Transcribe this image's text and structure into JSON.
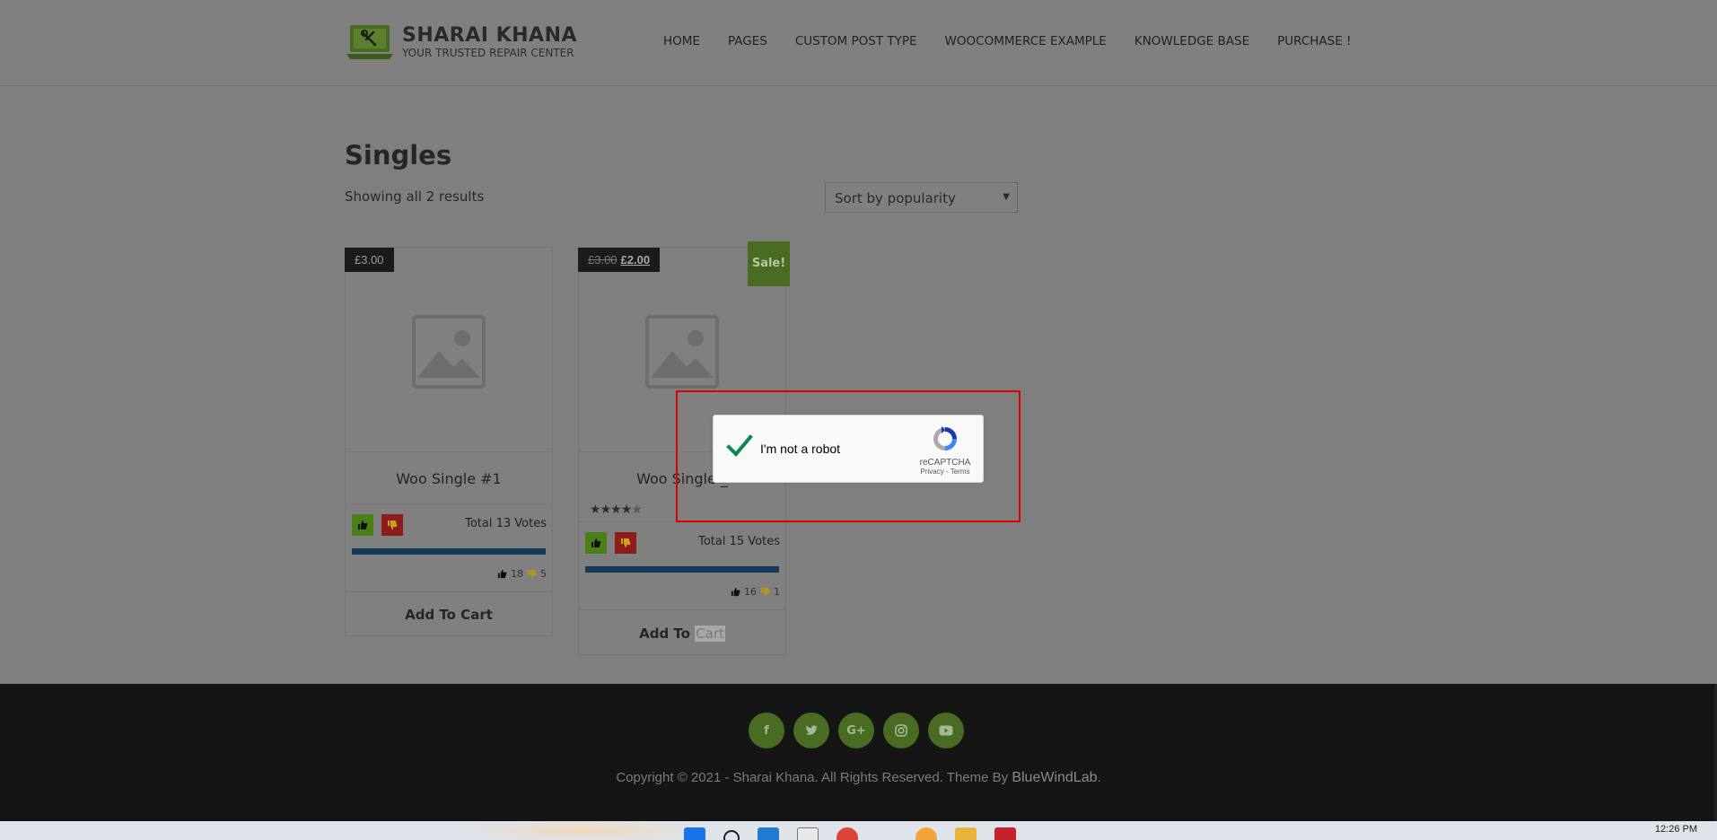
{
  "header": {
    "site_title": "SHARAI KHANA",
    "tagline": "YOUR TRUSTED REPAIR CENTER",
    "nav": [
      "HOME",
      "PAGES",
      "CUSTOM POST TYPE",
      "WOOCOMMERCE EXAMPLE",
      "KNOWLEDGE BASE",
      "PURCHASE !"
    ]
  },
  "main": {
    "title": "Singles",
    "result_count": "Showing all 2 results",
    "sort": {
      "selected": "Sort by popularity"
    }
  },
  "products": [
    {
      "name": "Woo Single #1",
      "price": "£3.00",
      "total_votes": "Total 13 Votes",
      "up": "18",
      "down": "5",
      "add_to_cart_a": "Add To Cart",
      "up_fraction": 1.0
    },
    {
      "name": "Woo Single _",
      "price_old": "£3.00",
      "price_new": "£2.00",
      "sale": "Sale!",
      "rating": 4.5,
      "total_votes": "Total 15 Votes",
      "up": "16",
      "down": "1",
      "add_to_cart_a": "Add To ",
      "add_to_cart_b": "Cart",
      "up_fraction": 1.0
    }
  ],
  "captcha": {
    "label": "I'm not a robot",
    "brand": "reCAPTCHA",
    "links": "Privacy - Terms"
  },
  "footer": {
    "social": [
      "f",
      "t",
      "G+",
      "ig",
      "yt"
    ],
    "copyright": "Copyright © 2021 - Sharai Khana. All Rights Reserved. Theme By ",
    "theme_by": "BlueWindLab",
    "period": "."
  },
  "taskbar": {
    "time": "12:26 PM"
  },
  "colors": {
    "accent_green": "#4a6b22",
    "vote_up": "#4b7f18",
    "vote_down": "#8e1c1c",
    "vote_bar": "#143a5e",
    "captcha_frame": "#e00000"
  }
}
